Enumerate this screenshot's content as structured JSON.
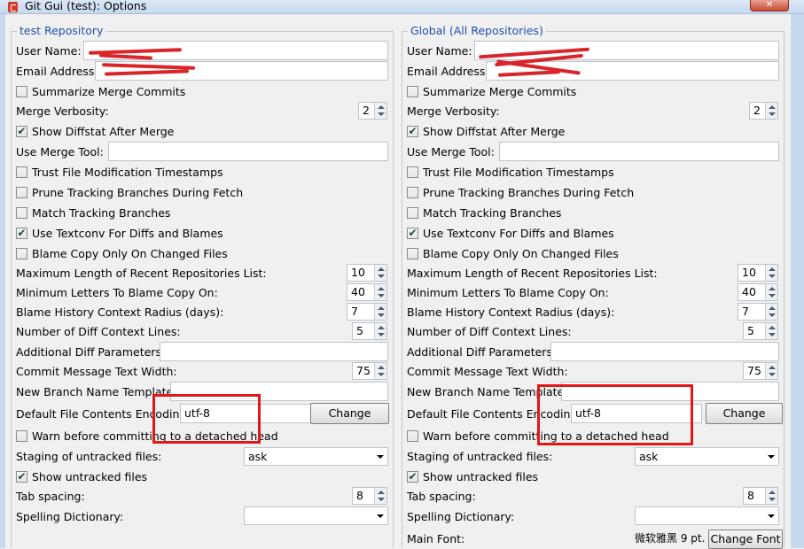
{
  "window": {
    "title": "Git Gui (test): Options",
    "close_label": "✕"
  },
  "repo_section": {
    "title": "test Repository",
    "user_name_label": "User Name:",
    "email_label": "Email Address:",
    "summarize_label": "Summarize Merge Commits",
    "summarize_checked": false,
    "verbosity_label": "Merge Verbosity:",
    "verbosity_value": "2",
    "diffstat_label": "Show Diffstat After Merge",
    "diffstat_checked": true,
    "merge_tool_label": "Use Merge Tool:",
    "trust_label": "Trust File Modification Timestamps",
    "trust_checked": false,
    "prune_label": "Prune Tracking Branches During Fetch",
    "prune_checked": false,
    "match_label": "Match Tracking Branches",
    "match_checked": false,
    "textconv_label": "Use Textconv For Diffs and Blames",
    "textconv_checked": true,
    "blame_copy_label": "Blame Copy Only On Changed Files",
    "blame_copy_checked": false,
    "max_recent_label": "Maximum Length of Recent Repositories List:",
    "max_recent_value": "10",
    "min_letters_label": "Minimum Letters To Blame Copy On:",
    "min_letters_value": "40",
    "blame_radius_label": "Blame History Context Radius (days):",
    "blame_radius_value": "7",
    "diff_lines_label": "Number of Diff Context Lines:",
    "diff_lines_value": "5",
    "diff_params_label": "Additional Diff Parameters:",
    "commit_width_label": "Commit Message Text Width:",
    "commit_width_value": "75",
    "branch_template_label": "New Branch Name Template:",
    "encoding_label": "Default File Contents Encoding:",
    "encoding_value": "utf-8",
    "change_label": "Change",
    "warn_detached_label": "Warn before committing to a detached head",
    "warn_detached_checked": false,
    "staging_label": "Staging of untracked files:",
    "staging_value": "ask",
    "show_untracked_label": "Show untracked files",
    "show_untracked_checked": true,
    "tab_spacing_label": "Tab spacing:",
    "tab_spacing_value": "8",
    "spelling_label": "Spelling Dictionary:",
    "spelling_value": ""
  },
  "global_section": {
    "title": "Global (All Repositories)",
    "user_name_label": "User Name:",
    "email_label": "Email Address:",
    "summarize_label": "Summarize Merge Commits",
    "summarize_checked": false,
    "verbosity_label": "Merge Verbosity:",
    "verbosity_value": "2",
    "diffstat_label": "Show Diffstat After Merge",
    "diffstat_checked": true,
    "merge_tool_label": "Use Merge Tool:",
    "trust_label": "Trust File Modification Timestamps",
    "trust_checked": false,
    "prune_label": "Prune Tracking Branches During Fetch",
    "prune_checked": false,
    "match_label": "Match Tracking Branches",
    "match_checked": false,
    "textconv_label": "Use Textconv For Diffs and Blames",
    "textconv_checked": true,
    "blame_copy_label": "Blame Copy Only On Changed Files",
    "blame_copy_checked": false,
    "max_recent_label": "Maximum Length of Recent Repositories List:",
    "max_recent_value": "10",
    "min_letters_label": "Minimum Letters To Blame Copy On:",
    "min_letters_value": "40",
    "blame_radius_label": "Blame History Context Radius (days):",
    "blame_radius_value": "7",
    "diff_lines_label": "Number of Diff Context Lines:",
    "diff_lines_value": "5",
    "diff_params_label": "Additional Diff Parameters:",
    "commit_width_label": "Commit Message Text Width:",
    "commit_width_value": "75",
    "branch_template_label": "New Branch Name Template:",
    "encoding_label": "Default File Contents Encoding:",
    "encoding_value": "utf-8",
    "change_label": "Change",
    "warn_detached_label": "Warn before committing to a detached head",
    "warn_detached_checked": false,
    "staging_label": "Staging of untracked files:",
    "staging_value": "ask",
    "show_untracked_label": "Show untracked files",
    "show_untracked_checked": true,
    "tab_spacing_label": "Tab spacing:",
    "tab_spacing_value": "8",
    "spelling_label": "Spelling Dictionary:",
    "spelling_value": "",
    "main_font_label": "Main Font:",
    "main_font_value": "微软雅黑 9 pt.",
    "change_font_label": "Change Font"
  },
  "colors": {
    "section_title": "#1f4fa8",
    "highlight_box": "#e01818",
    "redaction": "#d9252a"
  }
}
